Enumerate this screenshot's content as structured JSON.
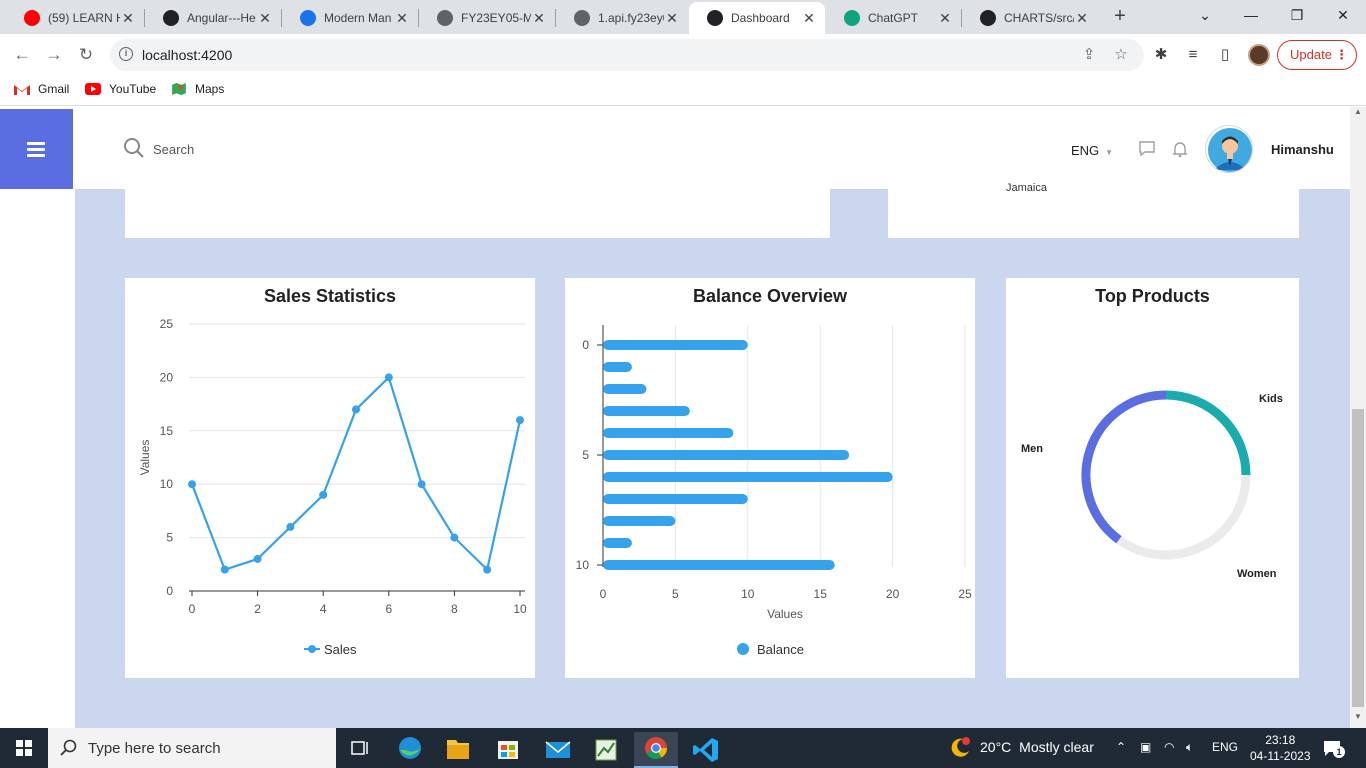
{
  "browser": {
    "tabs": [
      {
        "title": "(59) LEARN H",
        "icon": "youtube-icon",
        "color": "#ff0000"
      },
      {
        "title": "Angular---He",
        "icon": "github-icon",
        "color": "#202124"
      },
      {
        "title": "Modern Man",
        "icon": "app-icon",
        "color": "#1a73e8"
      },
      {
        "title": "FY23EY05-M",
        "icon": "globe-icon",
        "color": "#5f6368"
      },
      {
        "title": "1.api.fy23ey0",
        "icon": "globe-icon",
        "color": "#5f6368"
      },
      {
        "title": "Dashboard",
        "icon": "angular-icon",
        "color": "#202124"
      },
      {
        "title": "ChatGPT",
        "icon": "chatgpt-icon",
        "color": "#10a37f"
      },
      {
        "title": "CHARTS/src/",
        "icon": "github-icon",
        "color": "#202124"
      }
    ],
    "url": "localhost:4200",
    "update_label": "Update",
    "bookmarks": [
      {
        "label": "Gmail",
        "icon": "gmail-icon"
      },
      {
        "label": "YouTube",
        "icon": "youtube-icon"
      },
      {
        "label": "Maps",
        "icon": "maps-icon"
      }
    ]
  },
  "header": {
    "search_label": "Search",
    "language": "ENG",
    "username": "Himanshu"
  },
  "top_card": {
    "partial_text": "Jamaica"
  },
  "charts_text": {
    "sales_title": "Sales Statistics",
    "balance_title": "Balance Overview",
    "products_title": "Top Products"
  },
  "chart_data": [
    {
      "type": "line",
      "title": "Sales Statistics",
      "xlabel": "",
      "ylabel": "Values",
      "x": [
        0,
        1,
        2,
        3,
        4,
        5,
        6,
        7,
        8,
        9,
        10
      ],
      "x_ticks": [
        "0",
        "2",
        "4",
        "6",
        "8",
        "10"
      ],
      "y_ticks": [
        "0",
        "5",
        "10",
        "15",
        "20",
        "25"
      ],
      "series": [
        {
          "name": "Sales",
          "values": [
            10,
            2,
            3,
            6,
            9,
            17,
            20,
            10,
            5,
            2,
            16
          ]
        }
      ],
      "ylim": [
        0,
        25
      ],
      "xlim": [
        0,
        10
      ],
      "grid": true,
      "legend": "bottom",
      "color": "#36a2eb"
    },
    {
      "type": "bar",
      "orientation": "horizontal",
      "title": "Balance Overview",
      "xlabel": "Values",
      "ylabel": "",
      "categories": [
        0,
        1,
        2,
        3,
        4,
        5,
        6,
        7,
        8,
        9,
        10
      ],
      "y_ticks": [
        "0",
        "5",
        "10"
      ],
      "x_ticks": [
        "0",
        "5",
        "10",
        "15",
        "20",
        "25"
      ],
      "series": [
        {
          "name": "Balance",
          "values": [
            10,
            2,
            3,
            6,
            9,
            17,
            20,
            10,
            5,
            2,
            16
          ]
        }
      ],
      "xlim": [
        0,
        25
      ],
      "grid": true,
      "legend": "bottom",
      "color": "#36a2eb"
    },
    {
      "type": "pie",
      "subtype": "doughnut",
      "title": "Top Products",
      "labels": [
        "Kids",
        "Women",
        "Men"
      ],
      "values": [
        25,
        35,
        40
      ],
      "colors": [
        "#1aacad",
        "#ebebeb",
        "#5b6ee1"
      ]
    }
  ],
  "taskbar": {
    "search_placeholder": "Type here to search",
    "weather_temp": "20°C",
    "weather_text": "Mostly clear",
    "lang": "ENG",
    "time": "23:18",
    "date": "04-11-2023",
    "notif_count": "1"
  }
}
